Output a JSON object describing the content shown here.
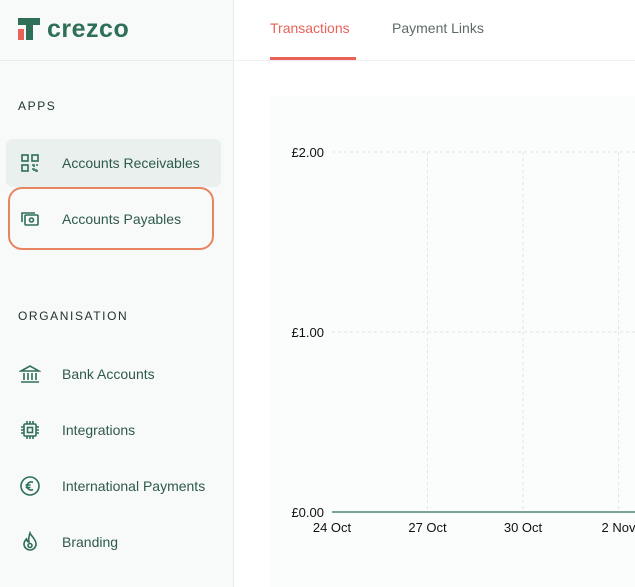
{
  "brand": {
    "name": "crezco"
  },
  "sidebar": {
    "apps_label": "APPS",
    "apps": [
      {
        "label": "Accounts Receivables",
        "icon": "qr-code-icon"
      },
      {
        "label": "Accounts Payables",
        "icon": "cash-icon"
      }
    ],
    "organisation_label": "ORGANISATION",
    "organisation": [
      {
        "label": "Bank Accounts",
        "icon": "bank-icon"
      },
      {
        "label": "Integrations",
        "icon": "chip-icon"
      },
      {
        "label": "International Payments",
        "icon": "euro-icon"
      },
      {
        "label": "Branding",
        "icon": "flame-icon"
      }
    ]
  },
  "tabs": [
    {
      "label": "Transactions",
      "active": true
    },
    {
      "label": "Payment Links",
      "active": false
    }
  ],
  "colors": {
    "accent": "#e8625a",
    "brand": "#2f6f57",
    "highlight": "#e88561"
  },
  "chart_data": {
    "type": "line",
    "x": [
      "24 Oct",
      "27 Oct",
      "30 Oct",
      "2 Nov"
    ],
    "yticks": [
      "£0.00",
      "£1.00",
      "£2.00"
    ],
    "ylim": [
      0,
      2
    ],
    "series": [
      {
        "values": [
          0,
          0,
          0,
          0
        ]
      }
    ],
    "grid": true
  }
}
